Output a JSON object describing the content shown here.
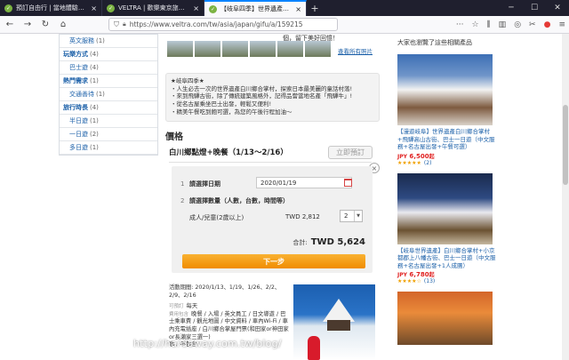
{
  "browser": {
    "tabs": [
      {
        "title": "預訂自由行 | 當地體驗以及門票",
        "active": false
      },
      {
        "title": "VELTRA | 歡樂東京旅遊 百萬旅",
        "active": false
      },
      {
        "title": "【岐阜四季】世界遺產白川鄉…",
        "active": true
      }
    ],
    "url": "https://www.veltra.com/tw/asia/japan/gifu/a/159215",
    "new_tab_icon": "plus-icon"
  },
  "sidebar": {
    "rows": [
      {
        "label": "英文服務",
        "count": "(1)",
        "kind": "sub"
      },
      {
        "label": "玩樂方式",
        "count": "(4)",
        "kind": "cat"
      },
      {
        "label": "巴士遊",
        "count": "(4)",
        "kind": "sub"
      },
      {
        "label": "熱門需求",
        "count": "(1)",
        "kind": "cat"
      },
      {
        "label": "交通善待",
        "count": "(1)",
        "kind": "sub"
      },
      {
        "label": "旅行時長",
        "count": "(4)",
        "kind": "cat"
      },
      {
        "label": "半日遊",
        "count": "(1)",
        "kind": "sub"
      },
      {
        "label": "一日遊",
        "count": "(2)",
        "kind": "sub"
      },
      {
        "label": "多日遊",
        "count": "(1)",
        "kind": "sub"
      }
    ]
  },
  "gallery": {
    "caption": "個，留下美好回憶！",
    "more_photos": "查看所有照片"
  },
  "info_box": {
    "heading": "★岐阜四季★",
    "lines": [
      "・人生必去一次的世界遺產白川鄉合掌村，探索日本最美麗的童話村落!",
      "・來到飛驒古街，除了傳統建築風格外，記得品嘗當地名產「飛驒牛」!",
      "・從名古屋乘坐巴士出發，輕鬆又便利!",
      "・精美午餐吃到飽可選，為您的午後行程加油～"
    ]
  },
  "pricing": {
    "section_title": "價格",
    "product_title": "白川鄉點燈+晚餐（1/13～2/16）",
    "reserve_label": "立即預訂",
    "close_icon": "close-icon",
    "step1_num": "1",
    "step1_label": "請選擇日期",
    "date_value": "2020/01/19",
    "step2_num": "2",
    "step2_label": "請選擇數量（人數，台數，時間等）",
    "pax_label": "成人/兒童(2歲以上)",
    "pax_price": "TWD 2,812",
    "qty_value": "2",
    "total_label": "合計:",
    "total_value": "TWD 5,624",
    "next_label": "下一步"
  },
  "details": {
    "period_label": "活動期間:",
    "period_value": "2020/1/13、1/19、1/26、2/2、2/9、2/16",
    "days_key": "可預訂",
    "days_value": "每天",
    "includes_key": "費用包含",
    "includes_value": "晚餐 / 入場 / 英文員工 / 日文導遊 / 巴士乘車費 / 觀光地圖 / 中文資料 / 車內Wi-Fi / 車內充電插座 / 白川鄉合掌屋門票(和田家or神田家or長瀨家三選一)",
    "trailing": "享。不包含"
  },
  "recommend": {
    "heading": "大家也瀏覽了這些相關產品",
    "items": [
      {
        "title": "【漫遊岐阜】世界遺產白川鄉合掌村+飛驒高山古街、巴士一日遊（中文服務+名古屋出發+午餐可選）",
        "price_prefix": "JPY",
        "price": "6,500",
        "price_suffix": "起",
        "stars": "★★★★★",
        "reviews": "(2)"
      },
      {
        "title": "【岐阜世界遺產】白川鄉合掌村+小京都郡上八幡古街、巴士一日遊（中文服務+名古屋出發+1人成團）",
        "price_prefix": "JPY",
        "price": "6,780",
        "price_suffix": "起",
        "stars": "★★★★☆",
        "reviews": "(13)"
      }
    ]
  },
  "watermark": "http://hardaway.com.tw/blog/"
}
